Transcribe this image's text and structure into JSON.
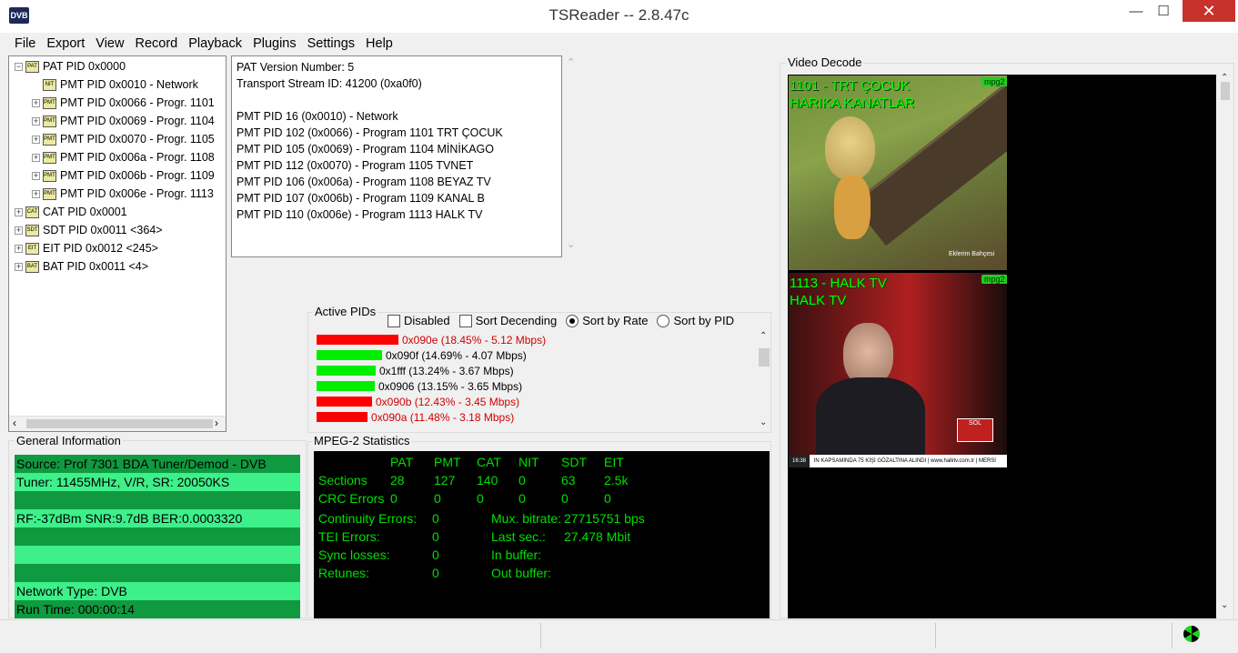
{
  "window": {
    "title": "TSReader -- 2.8.47c",
    "icon_label": "DVB",
    "minimize": "—",
    "maximize": "☐",
    "close": "✕"
  },
  "menu": [
    "File",
    "Export",
    "View",
    "Record",
    "Playback",
    "Plugins",
    "Settings",
    "Help"
  ],
  "tree": [
    {
      "level": 0,
      "expander": "⊟",
      "icon": "PAT",
      "label": "PAT PID 0x0000"
    },
    {
      "level": 1,
      "expander": "",
      "icon": "NIT",
      "label": "PMT PID 0x0010 - Network"
    },
    {
      "level": 1,
      "expander": "⊞",
      "icon": "PMT",
      "label": "PMT PID 0x0066 - Progr. 1101"
    },
    {
      "level": 1,
      "expander": "⊞",
      "icon": "PMT",
      "label": "PMT PID 0x0069 - Progr. 1104"
    },
    {
      "level": 1,
      "expander": "⊞",
      "icon": "PMT",
      "label": "PMT PID 0x0070 - Progr. 1105"
    },
    {
      "level": 1,
      "expander": "⊞",
      "icon": "PMT",
      "label": "PMT PID 0x006a - Progr. 1108"
    },
    {
      "level": 1,
      "expander": "⊞",
      "icon": "PMT",
      "label": "PMT PID 0x006b - Progr. 1109"
    },
    {
      "level": 1,
      "expander": "⊞",
      "icon": "PMT",
      "label": "PMT PID 0x006e - Progr. 1113"
    },
    {
      "level": 0,
      "expander": "⊞",
      "icon": "CAT",
      "label": "CAT PID 0x0001"
    },
    {
      "level": 0,
      "expander": "⊞",
      "icon": "SDT",
      "label": "SDT PID 0x0011 <364>"
    },
    {
      "level": 0,
      "expander": "⊞",
      "icon": "EIT",
      "label": "EIT PID 0x0012 <245>"
    },
    {
      "level": 0,
      "expander": "⊞",
      "icon": "BAT",
      "label": "BAT PID 0x0011 <4>"
    }
  ],
  "details": [
    "PAT Version Number: 5",
    "Transport Stream ID: 41200 (0xa0f0)",
    "",
    "PMT PID 16 (0x0010) - Network",
    "PMT PID 102 (0x0066) - Program 1101 TRT ÇOCUK",
    "PMT PID 105 (0x0069) - Program 1104 MİNİKAGO",
    "PMT PID 112 (0x0070) - Program 1105 TVNET",
    "PMT PID 106 (0x006a) - Program 1108 BEYAZ TV",
    "PMT PID 107 (0x006b) - Program 1109 KANAL B",
    "PMT PID 110 (0x006e) - Program 1113 HALK TV"
  ],
  "active_pids": {
    "label": "Active PIDs",
    "options": [
      {
        "type": "checkbox",
        "label": "Disabled",
        "checked": false
      },
      {
        "type": "checkbox",
        "label": "Sort Decending",
        "checked": false
      },
      {
        "type": "radio",
        "label": "Sort by Rate",
        "checked": true
      },
      {
        "type": "radio",
        "label": "Sort by PID",
        "checked": false
      }
    ],
    "rows": [
      {
        "text": "0x090e (18.45% - 5.12 Mbps)",
        "percent": 18.45,
        "color": "#ff0000",
        "text_color": "#d00000"
      },
      {
        "text": "0x090f (14.69% - 4.07 Mbps)",
        "percent": 14.69,
        "color": "#00ee00",
        "text_color": "#000000"
      },
      {
        "text": "0x1fff (13.24% - 3.67 Mbps)",
        "percent": 13.24,
        "color": "#00ee00",
        "text_color": "#000000"
      },
      {
        "text": "0x0906 (13.15% - 3.65 Mbps)",
        "percent": 13.15,
        "color": "#00ee00",
        "text_color": "#000000"
      },
      {
        "text": "0x090b (12.43% - 3.45 Mbps)",
        "percent": 12.43,
        "color": "#ff0000",
        "text_color": "#d00000"
      },
      {
        "text": "0x090a (11.48% - 3.18 Mbps)",
        "percent": 11.48,
        "color": "#ff0000",
        "text_color": "#d00000"
      }
    ]
  },
  "general_info": {
    "label": "General Information",
    "rows": [
      {
        "text": "Source: Prof 7301 BDA Tuner/Demod - DVB",
        "bg": "#109a40"
      },
      {
        "text": "Tuner: 11455MHz, V/R, SR: 20050KS",
        "bg": "#3ef08a"
      },
      {
        "text": "",
        "bg": "#109a40"
      },
      {
        "text": "RF:-37dBm SNR:9.7dB BER:0.0003320",
        "bg": "#3ef08a"
      },
      {
        "text": "",
        "bg": "#109a40"
      },
      {
        "text": "",
        "bg": "#3ef08a"
      },
      {
        "text": "",
        "bg": "#109a40"
      },
      {
        "text": "Network Type: DVB",
        "bg": "#3ef08a"
      },
      {
        "text": "Run Time: 000:00:14",
        "bg": "#109a40"
      }
    ]
  },
  "mpeg2": {
    "label": "MPEG-2 Statistics",
    "headers": [
      "PAT",
      "PMT",
      "CAT",
      "NIT",
      "SDT",
      "EIT"
    ],
    "sections_label": "Sections",
    "sections": [
      "28",
      "127",
      "140",
      "0",
      "63",
      "2.5k"
    ],
    "crc_label": "CRC Errors",
    "crc": [
      "0",
      "0",
      "0",
      "0",
      "0",
      "0"
    ],
    "continuity_label": "Continuity Errors:",
    "continuity": "0",
    "tei_label": "TEI Errors:",
    "tei": "0",
    "sync_label": "Sync losses:",
    "sync": "0",
    "retunes_label": "Retunes:",
    "retunes": "0",
    "mux_label": "Mux. bitrate:",
    "mux": "27715751 bps",
    "last_label": "Last sec.:",
    "last": "27.478 Mbit",
    "inbuf_label": "In buffer:",
    "outbuf_label": "Out buffer:"
  },
  "video": {
    "label": "Video Decode",
    "streams": [
      {
        "caption1": "1101 - TRT ÇOCUK",
        "caption2": "HARIKA KANATLAR",
        "codec": "mpg2",
        "bug": "Eklerim Bahçesi"
      },
      {
        "caption1": "1113 - HALK TV",
        "caption2": "HALK TV",
        "codec": "mpg2",
        "clock": "16:38",
        "ticker": "IN KAPSAMINDA 75 KİŞİ GÖZALTINA ALINDI | www.halktv.com.tr | MERSİ",
        "logo": "SOL"
      }
    ]
  },
  "colors": {
    "accent_green": "#00e000",
    "bar_red": "#ff0000",
    "bar_green": "#00ee00"
  }
}
